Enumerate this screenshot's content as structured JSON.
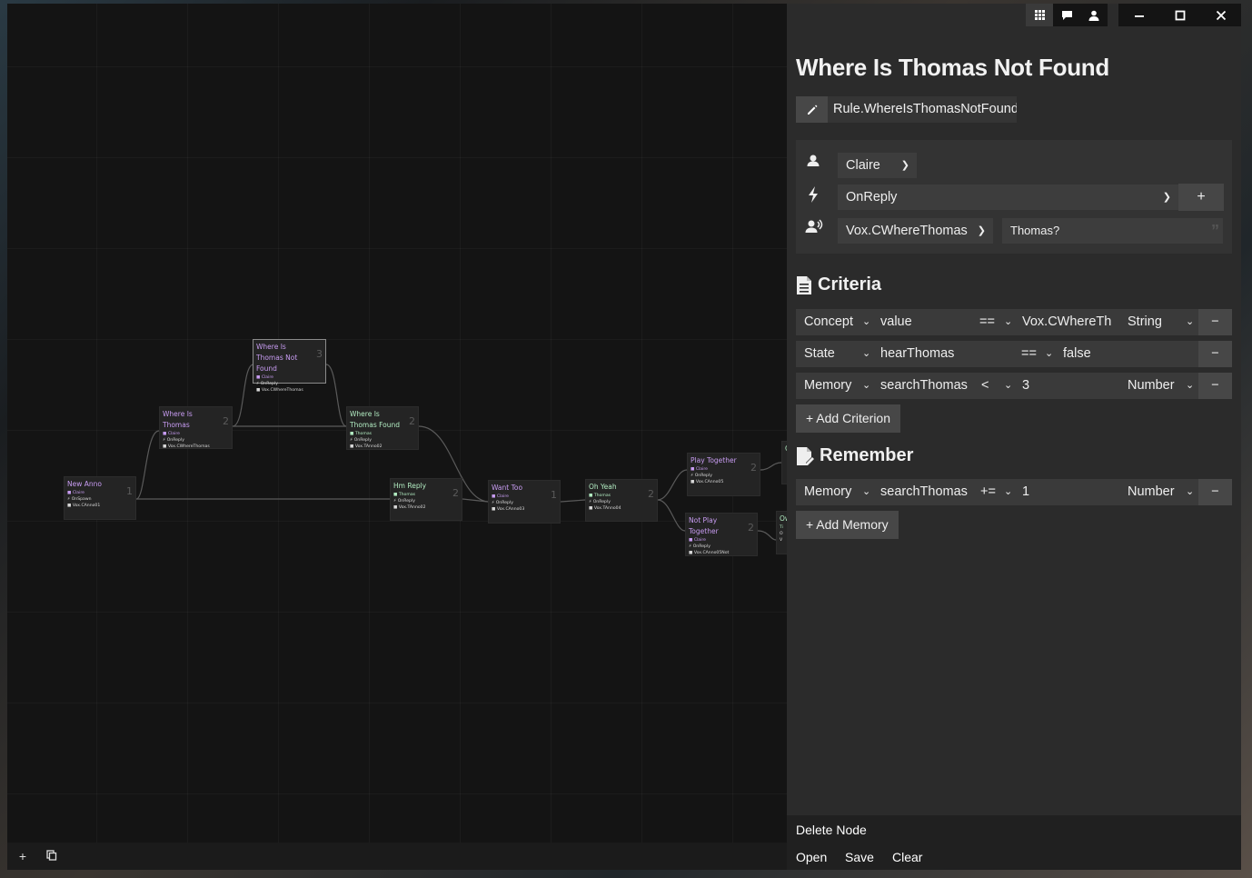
{
  "canvas": {
    "nodes": [
      {
        "id": "n1",
        "title": "New Anno",
        "title_color": "purple",
        "speaker": "Claire",
        "event": "OnSpawn",
        "vox": "Vox.CAnno01",
        "count": "1"
      },
      {
        "id": "n2",
        "title": "Where Is Thomas",
        "title_color": "purple",
        "speaker": "Claire",
        "event": "OnReply",
        "vox": "Vox.CWhereThomas",
        "count": "2"
      },
      {
        "id": "n3",
        "title": "Where Is Thomas Not Found",
        "title_color": "purple",
        "speaker": "Claire",
        "event": "OnReply",
        "vox": "Vox.CWhereThomas",
        "count": "3"
      },
      {
        "id": "n4",
        "title": "Where Is Thomas Found",
        "title_color": "green",
        "speaker": "Thomas",
        "event": "OnReply",
        "vox": "Vox.TAnno02",
        "count": "2"
      },
      {
        "id": "n5",
        "title": "Hm Reply",
        "title_color": "green",
        "speaker": "Thomas",
        "event": "OnReply",
        "vox": "Vox.TAnno02",
        "count": "2"
      },
      {
        "id": "n6",
        "title": "Want Too",
        "title_color": "purple",
        "speaker": "Claire",
        "event": "OnReply",
        "vox": "Vox.CAnno03",
        "count": "1"
      },
      {
        "id": "n7",
        "title": "Oh Yeah",
        "title_color": "green",
        "speaker": "Thomas",
        "event": "OnReply",
        "vox": "Vox.TAnno04",
        "count": "2"
      },
      {
        "id": "n8",
        "title": "Play Together",
        "title_color": "purple",
        "speaker": "Claire",
        "event": "OnReply",
        "vox": "Vox.CAnno05",
        "count": "2"
      },
      {
        "id": "n9",
        "title": "Not Play Together",
        "title_color": "purple",
        "speaker": "Claire",
        "event": "OnReply",
        "vox": "Vox.CAnno05Not",
        "count": "2"
      },
      {
        "id": "n10",
        "title": "C",
        "title_color": "green",
        "speaker": "",
        "event": "",
        "vox": "",
        "count": ""
      },
      {
        "id": "n11",
        "title": "Ow",
        "title_color": "green",
        "speaker": "Ti",
        "event": "O",
        "vox": "V",
        "count": ""
      }
    ],
    "add_icon": "plus-icon",
    "copy_icon": "copy-icon"
  },
  "window": {
    "buttons": [
      "grid-icon",
      "chat-icon",
      "person-icon"
    ],
    "controls": [
      "minimize-icon",
      "maximize-icon",
      "close-icon"
    ]
  },
  "panel": {
    "title": "Where Is Thomas Not Found",
    "rule_id": "Rule.WhereIsThomasNotFound",
    "speaker": "Claire",
    "event": "OnReply",
    "vox": "Vox.CWhereThomas",
    "line_placeholder": "Thomas?",
    "plus_label": "+",
    "criteria_title": "Criteria",
    "criteria": [
      {
        "type": "Concept",
        "key": "value",
        "op": "==",
        "value": "Vox.CWhereTh",
        "value_type": "String"
      },
      {
        "type": "State",
        "key": "hearThomas",
        "op": "==",
        "value": "false",
        "value_type": ""
      },
      {
        "type": "Memory",
        "key": "searchThomas",
        "op": "<",
        "value": "3",
        "value_type": "Number"
      }
    ],
    "add_criterion": "+ Add Criterion",
    "remember_title": "Remember",
    "remember": [
      {
        "type": "Memory",
        "key": "searchThomas",
        "op": "+=",
        "value": "1",
        "value_type": "Number"
      }
    ],
    "add_memory": "+ Add Memory",
    "delete_node": "Delete Node",
    "open": "Open",
    "save": "Save",
    "clear": "Clear",
    "minus_label": "−"
  }
}
